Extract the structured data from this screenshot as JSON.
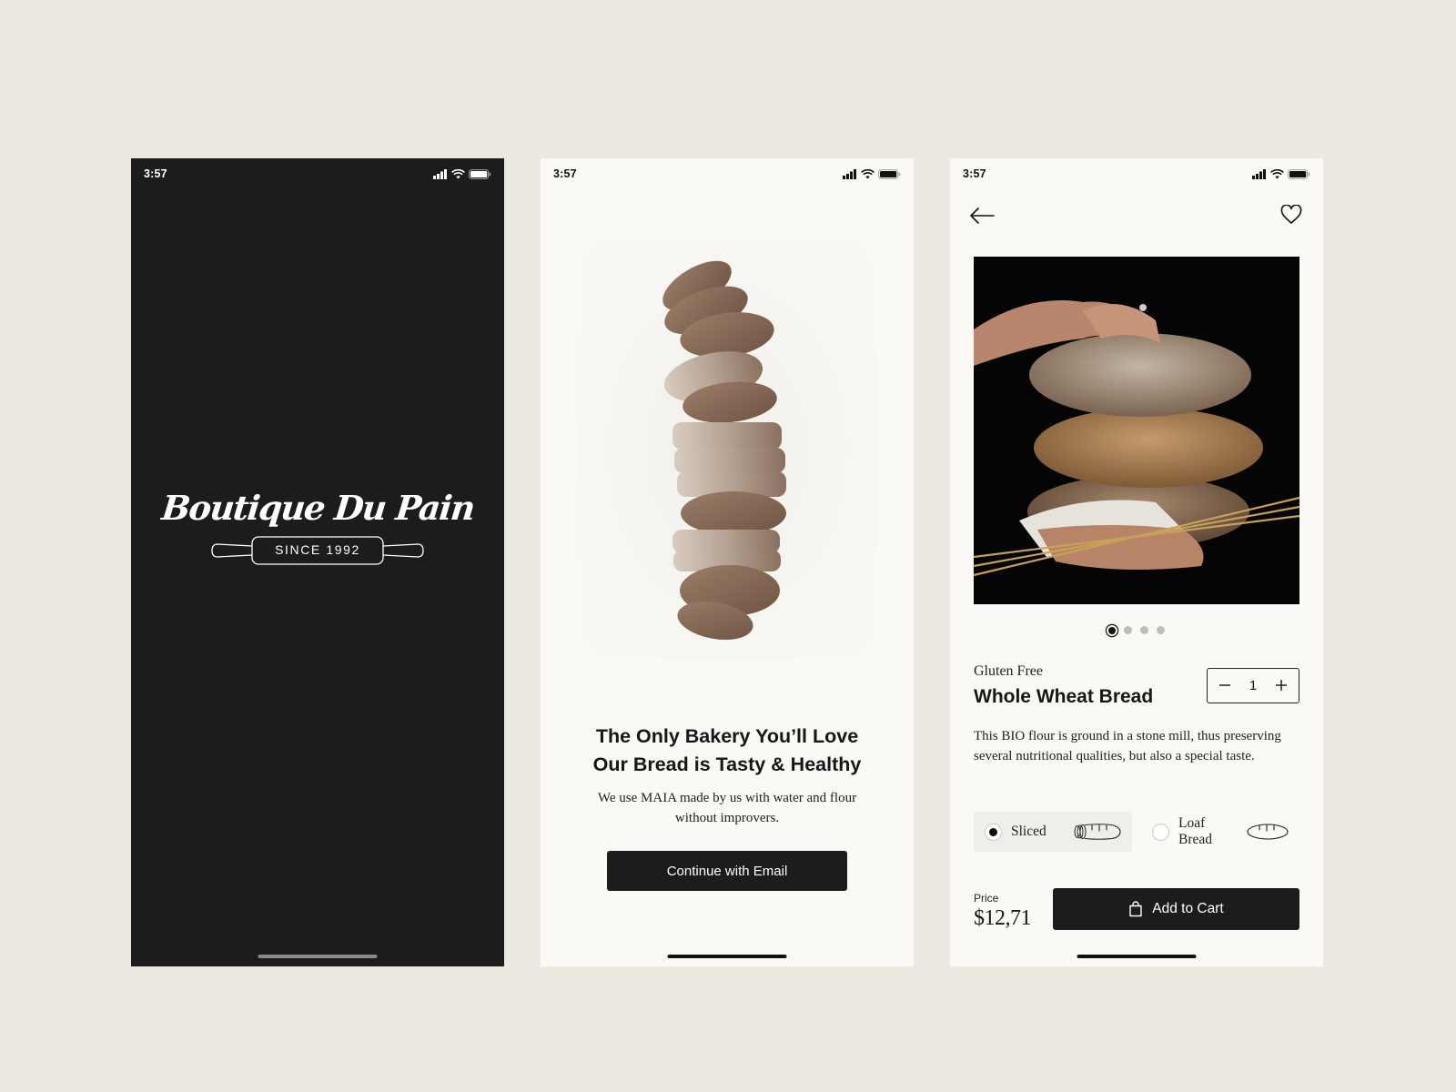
{
  "status_bar": {
    "time": "3:57"
  },
  "splash": {
    "brand_name": "Boutique Du Pain",
    "since_label": "SINCE 1992"
  },
  "onboarding": {
    "title_line1": "The Only Bakery You’ll Love",
    "title_line2": "Our Bread is Tasty & Healthy",
    "subtitle": "We use MAIA made by us with water and flour without improvers.",
    "cta_label": "Continue with Email"
  },
  "product": {
    "subtitle": "Gluten Free",
    "name": "Whole Wheat Bread",
    "quantity": "1",
    "description": "This BIO flour is ground in a stone mill, thus preserving several nutritional qualities, but also a special taste.",
    "image_pager": {
      "total": 4,
      "active_index": 0
    },
    "options": [
      {
        "label": "Sliced",
        "selected": true,
        "icon": "sliced-bread-icon"
      },
      {
        "label": "Loaf Bread",
        "selected": false,
        "icon": "loaf-bread-icon"
      }
    ],
    "price_label": "Price",
    "price": "$12,71",
    "add_to_cart_label": "Add to Cart"
  },
  "colors": {
    "page_background": "#ece9e0",
    "dark_screen": "#1c1c1c",
    "light_screen": "#faf9f6",
    "button": "#1c1c1c"
  }
}
